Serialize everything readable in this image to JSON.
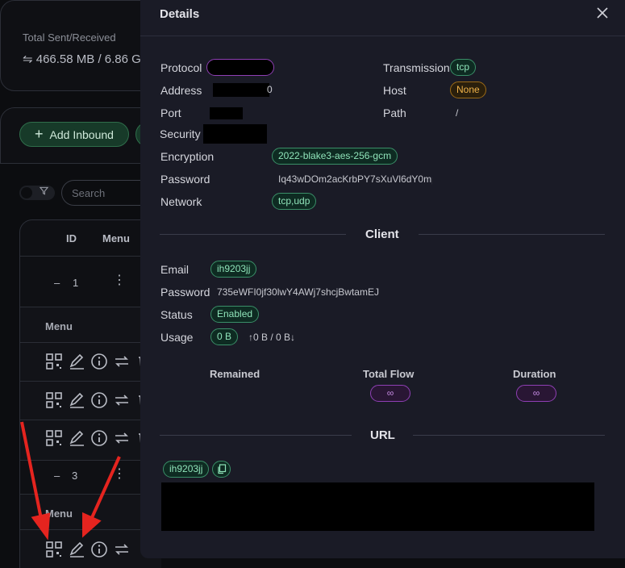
{
  "background": {
    "stats": {
      "label": "Total Sent/Received",
      "value": "⇋ 466.58 MB / 6.86 G"
    },
    "add_inbound_label": "Add Inbound",
    "filter_icon": "funnel-icon",
    "search_placeholder": "Search",
    "table": {
      "headers": {
        "id": "ID",
        "menu": "Menu"
      },
      "rows": [
        {
          "toggle": "–",
          "id": "1",
          "menu_icon": "more-vertical-icon"
        },
        {
          "toggle": "–",
          "id": "3",
          "menu_icon": "more-vertical-icon"
        }
      ],
      "sub_menu_label": "Menu"
    }
  },
  "modal": {
    "title": "Details",
    "fields": {
      "protocol_label": "Protocol",
      "address_label": "Address",
      "address_tail": "0",
      "port_label": "Port",
      "security_label": "Security",
      "encryption_label": "Encryption",
      "encryption_value": "2022-blake3-aes-256-gcm",
      "password_label": "Password",
      "password_value": "Iq43wDOm2acKrbPY7sXuVl6dY0mp",
      "network_label": "Network",
      "network_value": "tcp,udp",
      "transmission_label": "Transmission",
      "transmission_value": "tcp",
      "host_label": "Host",
      "host_value": "None",
      "path_label": "Path",
      "path_value": "/"
    },
    "client": {
      "title": "Client",
      "email_label": "Email",
      "email_value": "ih9203jj",
      "password_label": "Password",
      "password_value": "735eWFI0jf30lwY4AWj7shcjBwtamEJ",
      "status_label": "Status",
      "status_value": "Enabled",
      "usage_label": "Usage",
      "usage_value": "0 B",
      "usage_detail": "↑0 B / 0 B↓",
      "remained_label": "Remained",
      "total_flow_label": "Total Flow",
      "total_flow_value": "∞",
      "duration_label": "Duration",
      "duration_value": "∞"
    },
    "url": {
      "title": "URL",
      "email_tag": "ih9203jj",
      "copy_icon": "copy-icon"
    }
  },
  "colors": {
    "modal_bg": "#1a1b26",
    "tag_green": "#3a8f68",
    "tag_orange": "#9b6a16",
    "tag_purple": "#8f3fb4",
    "annotation_arrow": "#e5241f"
  }
}
